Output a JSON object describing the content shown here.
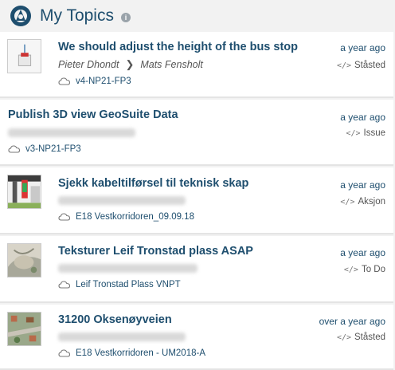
{
  "header": {
    "title": "My Topics",
    "info_icon": "i"
  },
  "items": [
    {
      "title": "We should adjust the height of the bus stop",
      "author": "Pieter Dhondt",
      "assignee": "Mats Fensholt",
      "project": "v4-NP21-FP3",
      "time": "a year ago",
      "status": "Ståsted",
      "thumbnail": "pin-model-thumbnail"
    },
    {
      "title": "Publish 3D view GeoSuite Data",
      "project": "v3-NP21-FP3",
      "time": "a year ago",
      "status": "Issue"
    },
    {
      "title": "Sjekk kabeltilførsel til teknisk skap",
      "project": "E18 Vestkorridoren_09.09.18",
      "time": "a year ago",
      "status": "Aksjon",
      "thumbnail": "cabinet-model-thumbnail"
    },
    {
      "title": "Teksturer Leif Tronstad plass ASAP",
      "project": "Leif Tronstad Plass VNPT",
      "time": "a year ago",
      "status": "To Do",
      "thumbnail": "plaza-model-thumbnail"
    },
    {
      "title": "31200 Oksenøyveien",
      "project": "E18 Vestkorridoren - UM2018-A",
      "time": "over a year ago",
      "status": "Ståsted",
      "thumbnail": "aerial-model-thumbnail"
    }
  ],
  "icons": {
    "status": "code-icon",
    "project": "cloud-icon",
    "assign": "chevron-right-icon"
  }
}
